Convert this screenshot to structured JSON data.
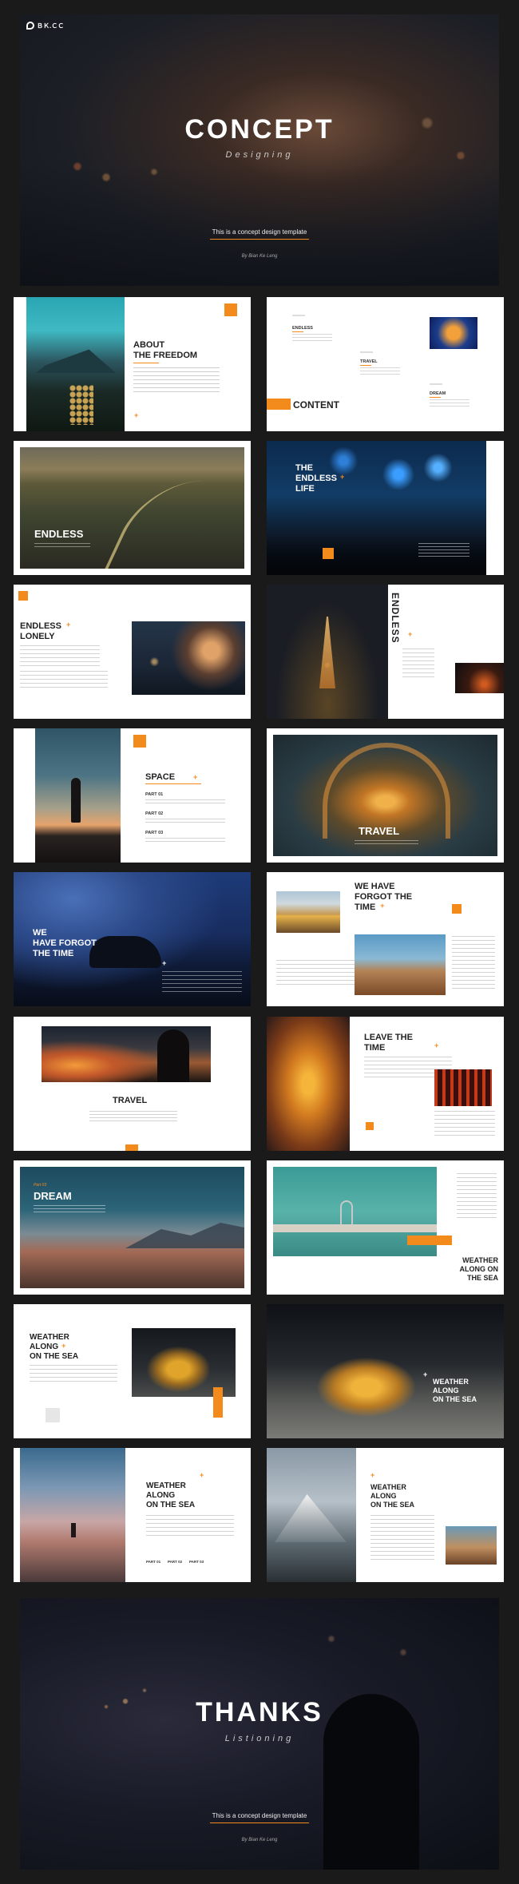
{
  "colors": {
    "accent": "#f28b1c",
    "page_bg": "#1a1a1a"
  },
  "cover": {
    "logo_text": "ＢＫ.ＣＣ",
    "title": "CONCEPT",
    "subtitle": "Designing",
    "tagline": "This is a concept design template",
    "author": "By Bian Ke Leng"
  },
  "slides": {
    "about": {
      "title_1": "ABOUT",
      "title_2": "THE FREEDOM"
    },
    "content": {
      "title": "CONTENT",
      "item_1": "ENDLESS",
      "item_2": "TRAVEL",
      "item_3": "DREAM"
    },
    "endless_road": {
      "title": "ENDLESS"
    },
    "endless_life": {
      "title_1": "THE",
      "title_2": "ENDLESS",
      "title_3": "LIFE"
    },
    "endless_lonely": {
      "title_1": "ENDLESS",
      "title_2": "LONELY"
    },
    "endless_vertical": {
      "title": "ENDLESS"
    },
    "space": {
      "title": "SPACE",
      "part_1": "PART 01",
      "part_2": "PART 02",
      "part_3": "PART 03"
    },
    "travel_arch": {
      "title": "TRAVEL"
    },
    "forgot_night": {
      "title_1": "WE",
      "title_2": "HAVE FORGOT",
      "title_3": "THE TIME"
    },
    "forgot_time": {
      "title_1": "WE HAVE",
      "title_2": "FORGOT THE",
      "title_3": "TIME"
    },
    "travel_sunset": {
      "title": "TRAVEL"
    },
    "leave_time": {
      "title_1": "LEAVE THE",
      "title_2": "TIME"
    },
    "dream": {
      "title": "DREAM",
      "kicker": "Part 03"
    },
    "weather_pool": {
      "title_1": "WEATHER",
      "title_2": "ALONG ON",
      "title_3": "THE SEA"
    },
    "weather_1": {
      "title_1": "WEATHER",
      "title_2": "ALONG",
      "title_3": "ON THE SEA"
    },
    "weather_cloak": {
      "title_1": "WEATHER",
      "title_2": "ALONG",
      "title_3": "ON THE SEA"
    },
    "weather_beach": {
      "title_1": "WEATHER",
      "title_2": "ALONG",
      "title_3": "ON THE SEA",
      "part_1": "PART 01",
      "part_2": "PART 02",
      "part_3": "PART 03"
    },
    "weather_mountain": {
      "title_1": "WEATHER",
      "title_2": "ALONG",
      "title_3": "ON THE SEA"
    }
  },
  "end": {
    "title": "THANKS",
    "subtitle": "Listioning",
    "tagline": "This is a concept design template",
    "author": "By Bian Ke Leng"
  }
}
